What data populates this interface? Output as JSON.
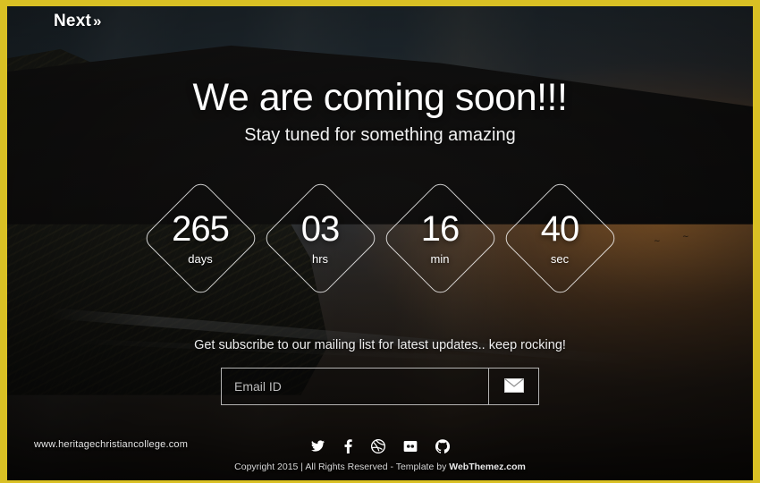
{
  "theme": {
    "frame_color": "#d9c024",
    "text_color": "#ffffff",
    "placeholder_color": "#bdbdbd"
  },
  "nav": {
    "next_label": "Next",
    "next_chevron": "»",
    "next_icon": "double-chevron-right-icon"
  },
  "hero": {
    "headline": "We are coming soon!!!",
    "subheadline": "Stay tuned for something amazing"
  },
  "countdown": {
    "units": [
      {
        "value": "265",
        "label": "days"
      },
      {
        "value": "03",
        "label": "hrs"
      },
      {
        "value": "16",
        "label": "min"
      },
      {
        "value": "40",
        "label": "sec"
      }
    ]
  },
  "subscribe": {
    "prompt": "Get subscribe to our mailing list for latest updates.. keep rocking!",
    "placeholder": "Email ID",
    "value": "",
    "submit_icon": "envelope-icon"
  },
  "watermark": {
    "text": "www.heritagechristiancollege.com"
  },
  "footer": {
    "socials": [
      {
        "name": "twitter-icon",
        "label": "Twitter"
      },
      {
        "name": "facebook-icon",
        "label": "Facebook"
      },
      {
        "name": "dribbble-icon",
        "label": "Dribbble"
      },
      {
        "name": "flickr-icon",
        "label": "Flickr"
      },
      {
        "name": "github-icon",
        "label": "GitHub"
      }
    ],
    "copyright_prefix": "Copyright 2015 | All Rights Reserved - Template by ",
    "copyright_brand": "WebThemez.com"
  }
}
